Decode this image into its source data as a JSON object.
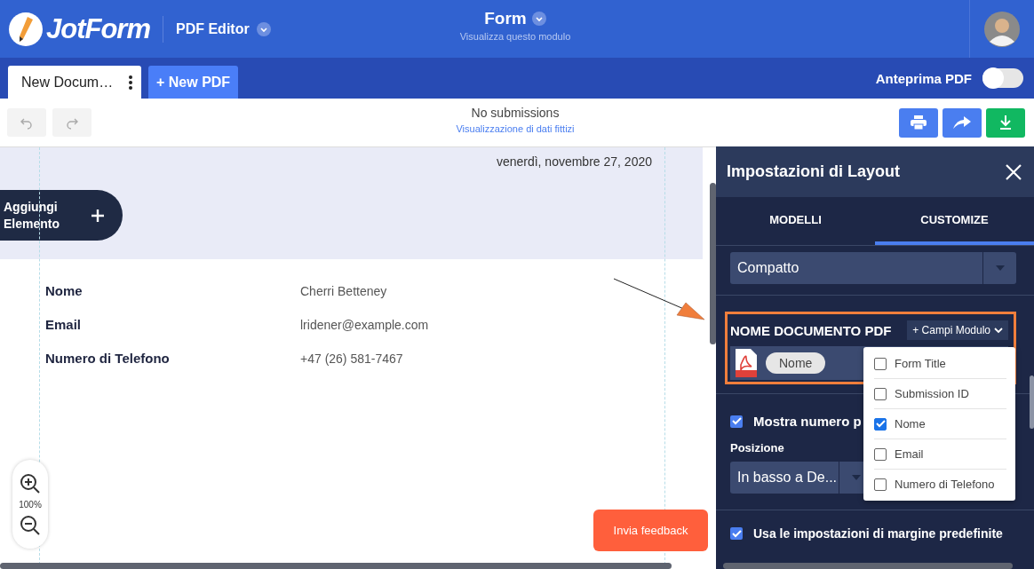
{
  "header": {
    "logo": "JotForm",
    "app": "PDF Editor",
    "form_title": "Form",
    "form_subtitle": "Visualizza questo modulo"
  },
  "tabs": [
    {
      "label": "New Docum…",
      "selected": true
    },
    {
      "label": "+ New PDF",
      "selected": false
    }
  ],
  "preview_toggle": {
    "label": "Anteprima PDF",
    "on": false
  },
  "toolbar": {
    "undo": {
      "disabled": true
    },
    "redo": {
      "disabled": true
    },
    "status": "No submissions",
    "status_link": "Visualizzazione di dati fittizi"
  },
  "document": {
    "date": "venerdì, novembre 27, 2020",
    "add_element": "Aggiungi Elemento",
    "fields": [
      {
        "label": "Nome",
        "value": "Cherri Betteney"
      },
      {
        "label": "Email",
        "value": "lridener@example.com"
      },
      {
        "label": "Numero di Telefono",
        "value": "+47 (26) 581-7467"
      }
    ],
    "zoom": "100%",
    "feedback": "Invia feedback"
  },
  "panel": {
    "title": "Impostazioni di Layout",
    "tabs": [
      {
        "label": "MODELLI",
        "selected": false
      },
      {
        "label": "CUSTOMIZE",
        "selected": true
      }
    ],
    "layout_select": "Compatto",
    "pdf_name": {
      "label": "NOME DOCUMENTO PDF",
      "add_fields": "+ Campi Modulo",
      "tag": "Nome"
    },
    "field_menu": [
      {
        "label": "Form Title",
        "checked": false
      },
      {
        "label": "Submission ID",
        "checked": false
      },
      {
        "label": "Nome",
        "checked": true
      },
      {
        "label": "Email",
        "checked": false
      },
      {
        "label": "Numero di Telefono",
        "checked": false
      }
    ],
    "page_number": {
      "label": "Mostra numero p",
      "checked": true
    },
    "position": {
      "label": "Posizione",
      "value": "In basso a De..."
    },
    "margins": {
      "label": "Usa le impostazioni di margine predefinite",
      "checked": true
    }
  }
}
